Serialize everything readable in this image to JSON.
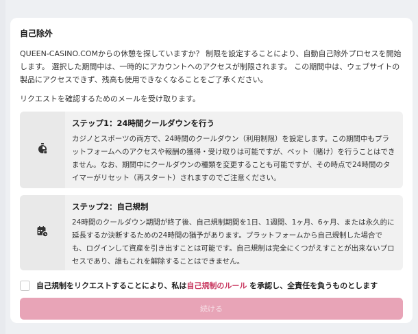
{
  "section": {
    "title": "自己除外",
    "description": "QUEEN-CASINO.COMからの休憩を探していますか？ 制限を設定することにより、自動自己除外プロセスを開始します。 選択した期間中は、一時的にアカウントへのアクセスが制限されます。 この期間中は、ウェブサイトの製品にアクセスできず、残高も使用できなくなることをご了承ください。",
    "confirm_note": "リクエストを確認するためのメールを受け取ります。"
  },
  "steps": [
    {
      "icon": "stopwatch-icon",
      "title": "ステップ1：24時間クールダウンを行う",
      "text": "カジノとスポーツの両方で、24時間のクールダウン（利用制限）を設定します。この期間中もプラットフォームへのアクセスや報酬の獲得・受け取りは可能ですが、ベット（賭け）を行うことはできません。なお、期間中にクールダウンの種類を変更することも可能ですが、その時点で24時間のタイマーがリセット（再スタート）されますのでご注意ください。"
    },
    {
      "icon": "calendar-clock-icon",
      "title": "ステップ2：自己規制",
      "text": "24時間のクールダウン期間が終了後、自己規制期間を1日、1週間、1ヶ月、6ヶ月、または永久的に延長するか決断するための24時間の猶予があります。プラットフォームから自己規制した場合でも、ログインして資産を引き出すことは可能です。自己規制は完全にくつがえすことが出来ないプロセスであり、誰もこれを解除することはできません。"
    }
  ],
  "agreement": {
    "checked": false,
    "text_before": "自己規制をリクエストすることにより、私は",
    "link_text": "自己規制のルール",
    "text_after": " を承認し、全責任を負うものとします"
  },
  "continue_button": {
    "label": "続ける",
    "enabled": false
  },
  "colors": {
    "accent_link": "#c8375f",
    "button_disabled_bg": "#e8a4b7"
  }
}
